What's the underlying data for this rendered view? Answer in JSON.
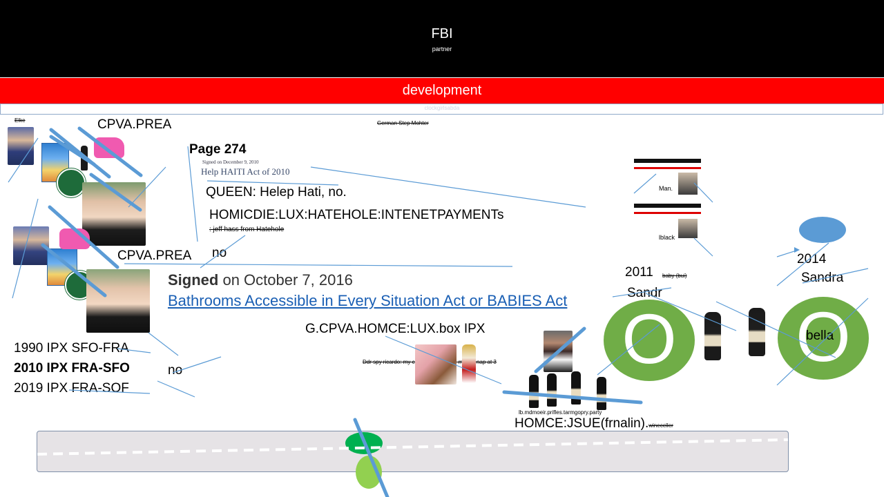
{
  "header": {
    "title": "FBI",
    "subtitle": "partner"
  },
  "banner": {
    "label": "development",
    "sublabel": "clockgirlsabda"
  },
  "texts": {
    "elke": "Elke",
    "cpva1": "CPVA.PREA",
    "cpva2": "CPVA.PREA",
    "german": "German Step Mohter",
    "page": "Page 274",
    "signed_small": "Signed on December 9, 2010",
    "help_haiti": "Help HAITI Act of 2010",
    "queen": "QUEEN: Helep Hati, no.",
    "homicdie": "HOMICDIE:LUX:HATEHOLE:INTENETPAYMENTs",
    "jeff": ": jeff hass from Hatehole",
    "no1": "no",
    "no2": "no",
    "signed_bold": "Signed",
    "signed_rest": " on October 7, 2016",
    "babies_link": "Bathrooms Accessible in Every Situation Act or BABIES Act",
    "gcpva": "G.CPVA.HOMCE:LUX.box  IPX",
    "ddr": "Ddr spy ricardo: my croatianbitch gave me shenap at 3",
    "ipx1990": "1990 IPX SFO-FRA",
    "ipx2010": "2010 IPX FRA-SFO",
    "ipx2019": "2019 IPX FRA-SOF",
    "lbmdmoeir": "lb.mdmoeir.prifles.tarmgopry.party",
    "homce_jsue": "HOMCE:JSUE(frnalin).",
    "wineceller": "wineceller",
    "y2011": "2011",
    "baby": "baby (bui)",
    "sandr": "Sandr",
    "y2014": "2014",
    "sandra": "Sandra",
    "bella": "bella",
    "circle_letter": "O",
    "man": "Man.",
    "iblack": "lblack"
  },
  "colors": {
    "header_bg": "#000000",
    "banner_bg": "#ff0000",
    "accent_blue": "#5b9bd5",
    "circle_green": "#70ad47",
    "link_blue": "#1a5fb4",
    "road_gray": "#e6e3e6"
  }
}
